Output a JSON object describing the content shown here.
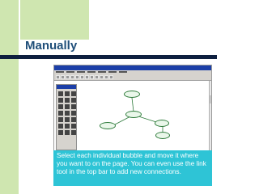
{
  "slide": {
    "title": "Manually",
    "caption": "Select each individual bubble and move it where you want to on the page. You can even use the link tool in the top bar to add new connections."
  },
  "colors": {
    "accent_green": "#cfe6b0",
    "title_blue": "#1f4e79",
    "rule_navy": "#0e1f3f",
    "caption_bg": "#2ec4d6",
    "bubble_green": "#2d7a3a"
  },
  "embedded_screenshot": {
    "window": {
      "title": ""
    },
    "bubble_count": 5
  }
}
